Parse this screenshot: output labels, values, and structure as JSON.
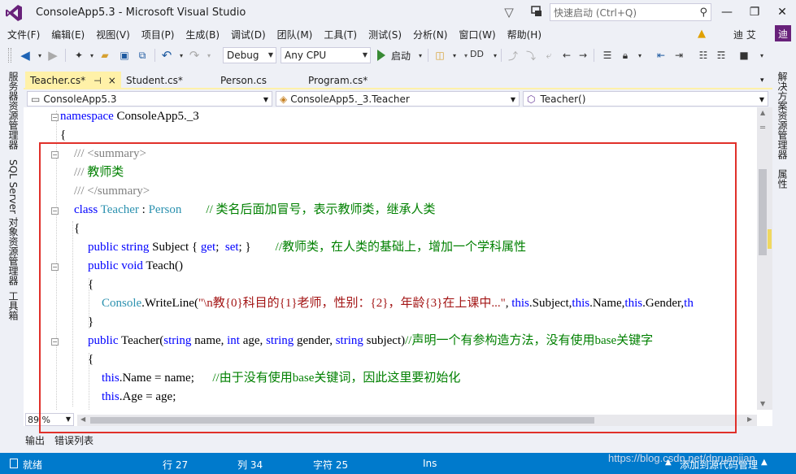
{
  "window": {
    "title": "ConsoleApp5.3 - Microsoft Visual Studio",
    "quick_launch_placeholder": "快速启动 (Ctrl+Q)",
    "user_name": "迪 艾",
    "avatar_letter": "迪"
  },
  "menu": [
    "文件(F)",
    "编辑(E)",
    "视图(V)",
    "项目(P)",
    "生成(B)",
    "调试(D)",
    "团队(M)",
    "工具(T)",
    "测试(S)",
    "分析(N)",
    "窗口(W)",
    "帮助(H)"
  ],
  "toolbar": {
    "configuration": "Debug",
    "platform": "Any CPU",
    "start_label": "启动",
    "layout_label": "DD"
  },
  "left_side_tabs": [
    "服务器资源管理器",
    "SQL Server 对象资源管理器",
    "工具箱"
  ],
  "right_side_tabs": [
    "解决方案资源管理器",
    "属性"
  ],
  "tabs": [
    {
      "label": "Teacher.cs*",
      "pin": "⊣",
      "close": "×",
      "active": true
    },
    {
      "label": "Student.cs*",
      "active": false
    },
    {
      "label": "Person.cs",
      "active": false
    },
    {
      "label": "Program.cs*",
      "active": false
    }
  ],
  "navbar": {
    "project": "ConsoleApp5.3",
    "class": "ConsoleApp5._3.Teacher",
    "member": "Teacher()"
  },
  "code": {
    "l1": {
      "kw": "namespace",
      "rest": " ConsoleApp5._3"
    },
    "l2": "{",
    "l3": {
      "gr1": "/// ",
      "tag": "<summary>"
    },
    "l4": {
      "gr1": "/// ",
      "cm": "教师类"
    },
    "l5": {
      "gr1": "/// ",
      "tag": "</summary>"
    },
    "l6": {
      "kw": "class ",
      "ty1": "Teacher",
      "mid": " : ",
      "ty2": "Person",
      "cm": "        // 类名后面加冒号，表示教师类，继承人类"
    },
    "l7": "{",
    "l8": {
      "kw1": "public ",
      "kw2": "string",
      "mid": " Subject { ",
      "kw3": "get",
      "mid2": ";  ",
      "kw4": "set",
      "mid3": "; }",
      "cm": "        //教师类，在人类的基础上，增加一个学科属性"
    },
    "l9": {
      "kw1": "public ",
      "kw2": "void",
      "rest": " Teach()"
    },
    "l10": "{",
    "l11": {
      "ty": "Console",
      "mid": ".WriteLine(",
      "st": "\"\\n教{0}科目的{1}老师，性别：{2}，年龄{3}在上课中...\"",
      "mid2": ", ",
      "kw1": "this",
      "mid3": ".Subject,",
      "kw2": "this",
      "mid4": ".Name,",
      "kw3": "this",
      "mid5": ".Gender,",
      "kw4": "th"
    },
    "l12": "}",
    "l13": {
      "kw1": "public ",
      "rest1": "Teacher(",
      "kw2": "string",
      "rest2": " name, ",
      "kw3": "int",
      "rest3": " age, ",
      "kw4": "string",
      "rest4": " gender, ",
      "kw5": "string",
      "rest5": " subject)",
      "cm": "//声明一个有参构造方法，没有使用base关键字"
    },
    "l14": "{",
    "l15": {
      "kw": "this",
      "rest": ".Name = name;",
      "cm": "      //由于没有使用base关键词，因此这里要初始化"
    },
    "l16": {
      "kw": "this",
      "rest": ".Age = age;"
    }
  },
  "zoom": "89 %",
  "bottom_tabs": [
    "输出",
    "错误列表"
  ],
  "status": {
    "ready": "就绪",
    "row": "行 27",
    "col": "列 34",
    "char": "字符 25",
    "mode": "Ins",
    "source_control": "添加到源代码管理"
  },
  "watermark": "https://blog.csdn.net/dnruanjian",
  "colors": {
    "accent": "#007acc",
    "keyword": "#0000ff",
    "type": "#2b91af",
    "comment": "#008000",
    "string": "#a31515",
    "highlight_box": "#e0302a"
  }
}
